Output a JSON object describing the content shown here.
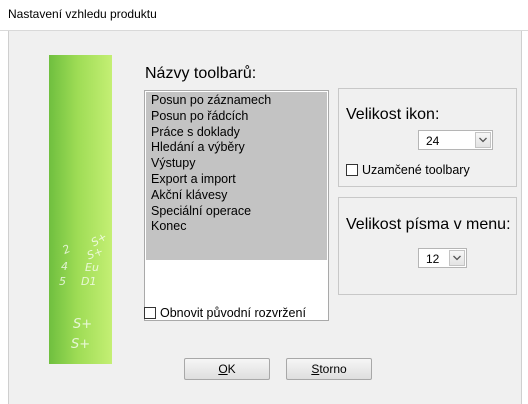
{
  "window": {
    "title": "Nastavení vzhledu produktu"
  },
  "toolbars": {
    "heading": "Názvy toolbarů:",
    "items": [
      "Posun po záznamech",
      "Posun po řádcích",
      "Práce s doklady",
      "Hledání a výběry",
      "Výstupy",
      "Export a import",
      "Akční klávesy",
      "Speciální operace",
      "Konec"
    ]
  },
  "icon_size": {
    "label": "Velikost ikon:",
    "value": "24",
    "locked_label": "Uzamčené toolbary",
    "locked_checked": false
  },
  "menu_font": {
    "label": "Velikost písma v menu:",
    "value": "12"
  },
  "restore": {
    "label": "Obnovit původní rozvržení",
    "checked": false
  },
  "buttons": {
    "ok_accel": "O",
    "ok_rest": "K",
    "cancel_accel": "S",
    "cancel_rest": "torno"
  },
  "banner": {
    "glyphs": [
      "S+",
      "2",
      "S+",
      "4",
      "Eu",
      "5",
      "D1",
      "S+",
      "S+"
    ]
  },
  "colors": {
    "banner": "#8fd24c",
    "selection": "#c3c3c3",
    "dialog": "#f0f0f0"
  },
  "icons": {
    "combo_arrow": "chevron-down-icon"
  }
}
